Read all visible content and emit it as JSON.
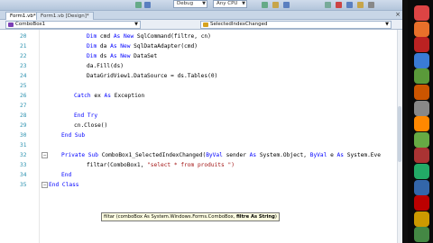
{
  "toolbar": {
    "debug": "Debug",
    "cpu": "Any CPU"
  },
  "tabs": [
    {
      "label": "Form1.vb*"
    },
    {
      "label": "Form1.vb [Design]*"
    }
  ],
  "navbar": {
    "object": "ComboBox1",
    "event": "SelectedIndexChanged"
  },
  "lines": [
    {
      "num": "20",
      "parts": [
        {
          "t": "kw",
          "s": "Dim"
        },
        {
          "t": "tx",
          "s": " cmd "
        },
        {
          "t": "kw",
          "s": "As New"
        },
        {
          "t": "tx",
          "s": " SqlCommand(filtre, cn)"
        }
      ]
    },
    {
      "num": "21",
      "parts": [
        {
          "t": "kw",
          "s": "Dim"
        },
        {
          "t": "tx",
          "s": " da "
        },
        {
          "t": "kw",
          "s": "As New"
        },
        {
          "t": "tx",
          "s": " SqlDataAdapter(cmd)"
        }
      ]
    },
    {
      "num": "22",
      "parts": [
        {
          "t": "kw",
          "s": "Dim"
        },
        {
          "t": "tx",
          "s": " ds "
        },
        {
          "t": "kw",
          "s": "As New"
        },
        {
          "t": "tx",
          "s": " DataSet"
        }
      ]
    },
    {
      "num": "23",
      "parts": [
        {
          "t": "tx",
          "s": "da.Fill(ds)"
        }
      ]
    },
    {
      "num": "24",
      "parts": [
        {
          "t": "tx",
          "s": "DataGridView1.DataSource = ds.Tables(0)"
        }
      ]
    },
    {
      "num": "25",
      "parts": []
    },
    {
      "num": "26",
      "parts": [
        {
          "t": "kw",
          "s": "Catch"
        },
        {
          "t": "tx",
          "s": " ex "
        },
        {
          "t": "kw",
          "s": "As"
        },
        {
          "t": "tx",
          "s": " Exception"
        }
      ]
    },
    {
      "num": "27",
      "parts": []
    },
    {
      "num": "28",
      "parts": [
        {
          "t": "kw",
          "s": "End Try"
        }
      ]
    },
    {
      "num": "29",
      "parts": [
        {
          "t": "tx",
          "s": "cn.Close()"
        }
      ]
    },
    {
      "num": "30",
      "parts": [
        {
          "t": "kw",
          "s": "End Sub"
        }
      ]
    },
    {
      "num": "31",
      "parts": []
    },
    {
      "num": "32",
      "parts": [
        {
          "t": "kw",
          "s": "Private Sub"
        },
        {
          "t": "tx",
          "s": " ComboBox1_SelectedIndexChanged("
        },
        {
          "t": "kw",
          "s": "ByVal"
        },
        {
          "t": "tx",
          "s": " sender "
        },
        {
          "t": "kw",
          "s": "As"
        },
        {
          "t": "tx",
          "s": " System.Object, "
        },
        {
          "t": "kw",
          "s": "ByVal"
        },
        {
          "t": "tx",
          "s": " e "
        },
        {
          "t": "kw",
          "s": "As"
        },
        {
          "t": "tx",
          "s": " System.Eve"
        }
      ]
    },
    {
      "num": "33",
      "parts": [
        {
          "t": "tx",
          "s": "filtar(ComboBox1, "
        },
        {
          "t": "st",
          "s": "\"select * from produits \")"
        }
      ]
    },
    {
      "num": "34",
      "parts": [
        {
          "t": "kw",
          "s": "End"
        }
      ]
    },
    {
      "num": "35",
      "parts": [
        {
          "t": "kw",
          "s": "End Class"
        }
      ]
    }
  ],
  "tooltip": {
    "pre": "filtar (comboBox As System.Windows.Forms.ComboBox, ",
    "bold": "filtre As String",
    "post": ")"
  },
  "dock_icons": [
    {
      "name": "chrome-icon",
      "color": "#d44"
    },
    {
      "name": "firefox-icon",
      "color": "#e8702a"
    },
    {
      "name": "ccleaner-icon",
      "color": "#b22"
    },
    {
      "name": "browser-icon",
      "color": "#3a7bd5"
    },
    {
      "name": "app-icon",
      "color": "#5a9a3a"
    },
    {
      "name": "media-icon",
      "color": "#cc5500"
    },
    {
      "name": "tool-icon",
      "color": "#888"
    },
    {
      "name": "vlc-icon",
      "color": "#ff8800"
    },
    {
      "name": "game-icon",
      "color": "#6a4"
    },
    {
      "name": "archive-icon",
      "color": "#a33"
    },
    {
      "name": "wrench-icon",
      "color": "#2a6"
    },
    {
      "name": "app2-icon",
      "color": "#36a"
    },
    {
      "name": "filezilla-icon",
      "color": "#b00"
    },
    {
      "name": "app3-icon",
      "color": "#c90"
    },
    {
      "name": "app4-icon",
      "color": "#484"
    }
  ]
}
